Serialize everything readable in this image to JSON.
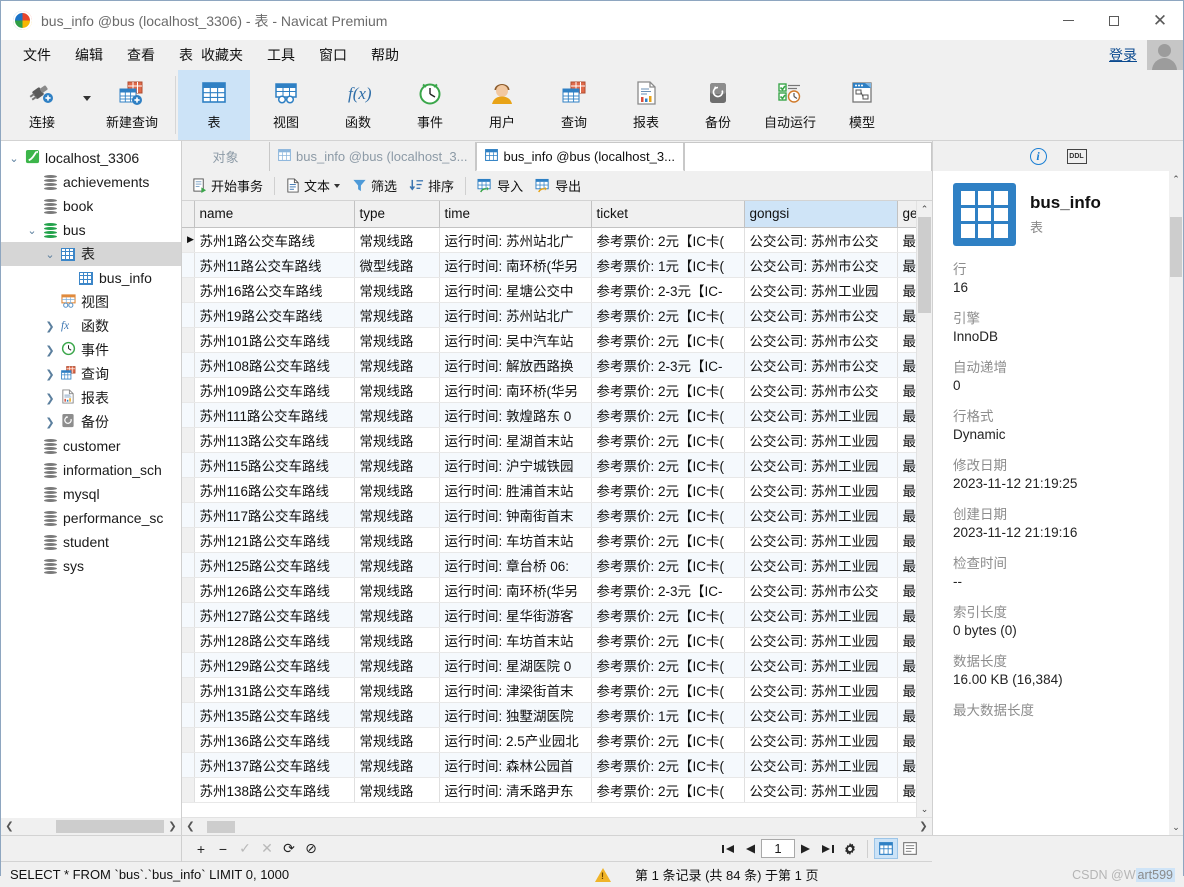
{
  "window": {
    "title": "bus_info @bus (localhost_3306) - 表 - Navicat Premium",
    "minimize": "minimize-icon",
    "maximize": "maximize-icon",
    "close": "close-icon"
  },
  "menubar": {
    "items": [
      "文件",
      "编辑",
      "查看",
      "表",
      "收藏夹",
      "工具",
      "窗口",
      "帮助"
    ],
    "login_label": "登录"
  },
  "toolbar": {
    "connection": {
      "label": "连接",
      "icon": "connection-plug-icon"
    },
    "new_query": {
      "label": "新建查询",
      "icon": "new-query-icon"
    },
    "items": [
      {
        "label": "表",
        "icon": "table-icon",
        "active": true
      },
      {
        "label": "视图",
        "icon": "view-icon",
        "active": false
      },
      {
        "label": "函数",
        "icon": "function-fx-icon",
        "active": false
      },
      {
        "label": "事件",
        "icon": "event-clock-icon",
        "active": false
      },
      {
        "label": "用户",
        "icon": "user-icon",
        "active": false
      },
      {
        "label": "查询",
        "icon": "query-icon",
        "active": false
      },
      {
        "label": "报表",
        "icon": "report-icon",
        "active": false
      },
      {
        "label": "备份",
        "icon": "backup-icon",
        "active": false
      },
      {
        "label": "自动运行",
        "icon": "automation-icon",
        "active": false
      },
      {
        "label": "模型",
        "icon": "model-icon",
        "active": false
      }
    ]
  },
  "sidebar": {
    "tree": [
      {
        "label": "localhost_3306",
        "depth": 0,
        "icon": "server-icon",
        "expanded": true,
        "selected": false
      },
      {
        "label": "achievements",
        "depth": 1,
        "icon": "database-icon",
        "expanded": null,
        "selected": false
      },
      {
        "label": "book",
        "depth": 1,
        "icon": "database-icon",
        "expanded": null,
        "selected": false
      },
      {
        "label": "bus",
        "depth": 1,
        "icon": "database-open-icon",
        "expanded": true,
        "selected": false
      },
      {
        "label": "表",
        "depth": 2,
        "icon": "table-folder-icon",
        "expanded": true,
        "selected": true
      },
      {
        "label": "bus_info",
        "depth": 3,
        "icon": "table-icon",
        "expanded": null,
        "selected": false
      },
      {
        "label": "视图",
        "depth": 2,
        "icon": "view-folder-icon",
        "expanded": null,
        "selected": false
      },
      {
        "label": "函数",
        "depth": 2,
        "icon": "function-fx-icon",
        "expanded": false,
        "selected": false
      },
      {
        "label": "事件",
        "depth": 2,
        "icon": "event-clock-icon",
        "expanded": false,
        "selected": false
      },
      {
        "label": "查询",
        "depth": 2,
        "icon": "query-icon",
        "expanded": false,
        "selected": false
      },
      {
        "label": "报表",
        "depth": 2,
        "icon": "report-icon",
        "expanded": false,
        "selected": false
      },
      {
        "label": "备份",
        "depth": 2,
        "icon": "backup-icon",
        "expanded": false,
        "selected": false
      },
      {
        "label": "customer",
        "depth": 1,
        "icon": "database-icon",
        "expanded": null,
        "selected": false
      },
      {
        "label": "information_sch",
        "depth": 1,
        "icon": "database-icon",
        "expanded": null,
        "selected": false
      },
      {
        "label": "mysql",
        "depth": 1,
        "icon": "database-icon",
        "expanded": null,
        "selected": false
      },
      {
        "label": "performance_sc",
        "depth": 1,
        "icon": "database-icon",
        "expanded": null,
        "selected": false
      },
      {
        "label": "student",
        "depth": 1,
        "icon": "database-icon",
        "expanded": null,
        "selected": false
      },
      {
        "label": "sys",
        "depth": 1,
        "icon": "database-icon",
        "expanded": null,
        "selected": false
      }
    ]
  },
  "tabs": {
    "object_label": "对象",
    "items": [
      {
        "label": "bus_info @bus (localhost_3...",
        "active": false
      },
      {
        "label": "bus_info @bus (localhost_3...",
        "active": true
      }
    ]
  },
  "grid_toolbar": {
    "begin_transaction": "开始事务",
    "text": "文本",
    "filter": "筛选",
    "sort": "排序",
    "import": "导入",
    "export": "导出"
  },
  "grid": {
    "columns": [
      "name",
      "type",
      "time",
      "ticket",
      "gongsi",
      "ge"
    ],
    "highlight_column": "gongsi",
    "rows": [
      {
        "name": "苏州1路公交车路线",
        "type": "常规线路",
        "time": "运行时间: 苏州站北广",
        "ticket": "参考票价: 2元【IC卡(",
        "gongsi": "公交公司: 苏州市公交",
        "ge": "最",
        "current": true
      },
      {
        "name": "苏州11路公交车路线",
        "type": "微型线路",
        "time": "运行时间: 南环桥(华另",
        "ticket": "参考票价: 1元【IC卡(",
        "gongsi": "公交公司: 苏州市公交",
        "ge": "最",
        "current": false
      },
      {
        "name": "苏州16路公交车路线",
        "type": "常规线路",
        "time": "运行时间: 星塘公交中",
        "ticket": "参考票价: 2-3元【IC-",
        "gongsi": "公交公司: 苏州工业园",
        "ge": "最",
        "current": false
      },
      {
        "name": "苏州19路公交车路线",
        "type": "常规线路",
        "time": "运行时间: 苏州站北广",
        "ticket": "参考票价: 2元【IC卡(",
        "gongsi": "公交公司: 苏州市公交",
        "ge": "最",
        "current": false
      },
      {
        "name": "苏州101路公交车路线",
        "type": "常规线路",
        "time": "运行时间: 吴中汽车站",
        "ticket": "参考票价: 2元【IC卡(",
        "gongsi": "公交公司: 苏州市公交",
        "ge": "最",
        "current": false
      },
      {
        "name": "苏州108路公交车路线",
        "type": "常规线路",
        "time": "运行时间: 解放西路换",
        "ticket": "参考票价: 2-3元【IC-",
        "gongsi": "公交公司: 苏州市公交",
        "ge": "最",
        "current": false
      },
      {
        "name": "苏州109路公交车路线",
        "type": "常规线路",
        "time": "运行时间: 南环桥(华另",
        "ticket": "参考票价: 2元【IC卡(",
        "gongsi": "公交公司: 苏州市公交",
        "ge": "最",
        "current": false
      },
      {
        "name": "苏州111路公交车路线",
        "type": "常规线路",
        "time": "运行时间: 敦煌路东 0",
        "ticket": "参考票价: 2元【IC卡(",
        "gongsi": "公交公司: 苏州工业园",
        "ge": "最",
        "current": false
      },
      {
        "name": "苏州113路公交车路线",
        "type": "常规线路",
        "time": "运行时间: 星湖首末站",
        "ticket": "参考票价: 2元【IC卡(",
        "gongsi": "公交公司: 苏州工业园",
        "ge": "最",
        "current": false
      },
      {
        "name": "苏州115路公交车路线",
        "type": "常规线路",
        "time": "运行时间: 沪宁城铁园",
        "ticket": "参考票价: 2元【IC卡(",
        "gongsi": "公交公司: 苏州工业园",
        "ge": "最",
        "current": false
      },
      {
        "name": "苏州116路公交车路线",
        "type": "常规线路",
        "time": "运行时间: 胜浦首末站",
        "ticket": "参考票价: 2元【IC卡(",
        "gongsi": "公交公司: 苏州工业园",
        "ge": "最",
        "current": false
      },
      {
        "name": "苏州117路公交车路线",
        "type": "常规线路",
        "time": "运行时间: 钟南街首末",
        "ticket": "参考票价: 2元【IC卡(",
        "gongsi": "公交公司: 苏州工业园",
        "ge": "最",
        "current": false
      },
      {
        "name": "苏州121路公交车路线",
        "type": "常规线路",
        "time": "运行时间: 车坊首末站",
        "ticket": "参考票价: 2元【IC卡(",
        "gongsi": "公交公司: 苏州工业园",
        "ge": "最",
        "current": false
      },
      {
        "name": "苏州125路公交车路线",
        "type": "常规线路",
        "time": "运行时间: 章台桥 06:",
        "ticket": "参考票价: 2元【IC卡(",
        "gongsi": "公交公司: 苏州工业园",
        "ge": "最",
        "current": false
      },
      {
        "name": "苏州126路公交车路线",
        "type": "常规线路",
        "time": "运行时间: 南环桥(华另",
        "ticket": "参考票价: 2-3元【IC-",
        "gongsi": "公交公司: 苏州市公交",
        "ge": "最",
        "current": false
      },
      {
        "name": "苏州127路公交车路线",
        "type": "常规线路",
        "time": "运行时间: 星华街游客",
        "ticket": "参考票价: 2元【IC卡(",
        "gongsi": "公交公司: 苏州工业园",
        "ge": "最",
        "current": false
      },
      {
        "name": "苏州128路公交车路线",
        "type": "常规线路",
        "time": "运行时间: 车坊首末站",
        "ticket": "参考票价: 2元【IC卡(",
        "gongsi": "公交公司: 苏州工业园",
        "ge": "最",
        "current": false
      },
      {
        "name": "苏州129路公交车路线",
        "type": "常规线路",
        "time": "运行时间: 星湖医院 0",
        "ticket": "参考票价: 2元【IC卡(",
        "gongsi": "公交公司: 苏州工业园",
        "ge": "最",
        "current": false
      },
      {
        "name": "苏州131路公交车路线",
        "type": "常规线路",
        "time": "运行时间: 津梁街首末",
        "ticket": "参考票价: 2元【IC卡(",
        "gongsi": "公交公司: 苏州工业园",
        "ge": "最",
        "current": false
      },
      {
        "name": "苏州135路公交车路线",
        "type": "常规线路",
        "time": "运行时间: 独墅湖医院",
        "ticket": "参考票价: 1元【IC卡(",
        "gongsi": "公交公司: 苏州工业园",
        "ge": "最",
        "current": false
      },
      {
        "name": "苏州136路公交车路线",
        "type": "常规线路",
        "time": "运行时间: 2.5产业园北",
        "ticket": "参考票价: 2元【IC卡(",
        "gongsi": "公交公司: 苏州工业园",
        "ge": "最",
        "current": false
      },
      {
        "name": "苏州137路公交车路线",
        "type": "常规线路",
        "time": "运行时间: 森林公园首",
        "ticket": "参考票价: 2元【IC卡(",
        "gongsi": "公交公司: 苏州工业园",
        "ge": "最",
        "current": false
      },
      {
        "name": "苏州138路公交车路线",
        "type": "常规线路",
        "time": "运行时间: 清禾路尹东",
        "ticket": "参考票价: 2元【IC卡(",
        "gongsi": "公交公司: 苏州工业园",
        "ge": "最",
        "current": false
      }
    ]
  },
  "info_panel": {
    "tab_info": "info-icon",
    "tab_ddl": "DDL",
    "table_name": "bus_info",
    "object_type": "表",
    "fields": [
      {
        "key": "行",
        "value": "16"
      },
      {
        "key": "引擎",
        "value": "InnoDB"
      },
      {
        "key": "自动递增",
        "value": "0"
      },
      {
        "key": "行格式",
        "value": "Dynamic"
      },
      {
        "key": "修改日期",
        "value": "2023-11-12 21:19:25"
      },
      {
        "key": "创建日期",
        "value": "2023-11-12 21:19:16"
      },
      {
        "key": "检查时间",
        "value": "--"
      },
      {
        "key": "索引长度",
        "value": "0 bytes (0)"
      },
      {
        "key": "数据长度",
        "value": "16.00 KB (16,384)"
      },
      {
        "key": "最大数据长度",
        "value": ""
      }
    ]
  },
  "record_bar": {
    "add": "+",
    "remove": "−",
    "apply": "✓",
    "cancel": "✕",
    "refresh": "⟳",
    "stop": "⊘",
    "first": "first-record-icon",
    "prev": "prev-record-icon",
    "page": "1",
    "next": "next-record-icon",
    "last": "last-record-icon",
    "settings": "gear-icon",
    "grid_view": "grid-view-icon",
    "form_view": "form-view-icon"
  },
  "status_bar": {
    "sql": "SELECT * FROM `bus`.`bus_info` LIMIT 0, 1000",
    "warning_icon": "warning-icon",
    "record_info": "第 1 条记录 (共 84 条) 于第 1 页",
    "watermark_prefix": "CSDN @W",
    "watermark_highlight": "art599"
  },
  "colors": {
    "accent": "#2f80c4",
    "tab_highlight": "#cce3f7",
    "selection": "#d6d6d6",
    "column_highlight": "#cfe4f7"
  }
}
